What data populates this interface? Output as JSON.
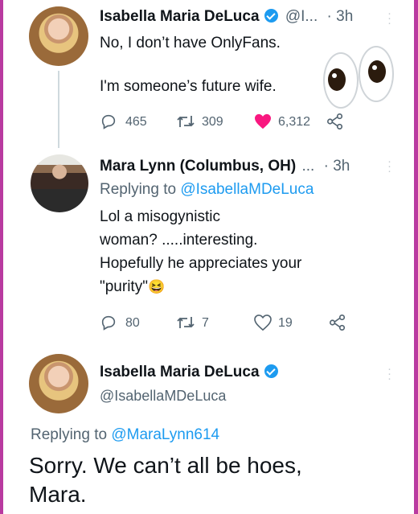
{
  "tweet1": {
    "name": "Isabella Maria DeLuca",
    "handle": "@I...",
    "time": "· 3h",
    "line1": "No, I don’t have OnlyFans.",
    "line2": "I'm someone’s future wife.",
    "replies": "465",
    "retweets": "309",
    "likes": "6,312"
  },
  "tweet2": {
    "name": "Mara Lynn (Columbus, OH)",
    "ellipsis": "...",
    "time": "· 3h",
    "replying_prefix": "Replying to",
    "replying_handle": "@IsabellaMDeLuca",
    "lines": [
      "Lol a misogynistic",
      "woman? .....interesting.",
      "Hopefully he appreciates your",
      "\"purity\""
    ],
    "emoji": "😆",
    "replies": "80",
    "retweets": "7",
    "likes": "19"
  },
  "tweet3": {
    "name": "Isabella Maria DeLuca",
    "handle": "@IsabellaMDeLuca",
    "replying_prefix": "Replying to",
    "replying_handle": "@MaraLynn614",
    "line1": "Sorry. We can’t all be hoes,",
    "line2": "Mara."
  },
  "colors": {
    "accent": "#1d9bf0",
    "like": "#f91880",
    "border": "#b93aa0",
    "text": "#0f1419",
    "muted": "#536471"
  },
  "icons": [
    "reply-icon",
    "retweet-icon",
    "heart-icon",
    "share-icon",
    "verified-icon",
    "more-icon",
    "eyes-emoji"
  ]
}
